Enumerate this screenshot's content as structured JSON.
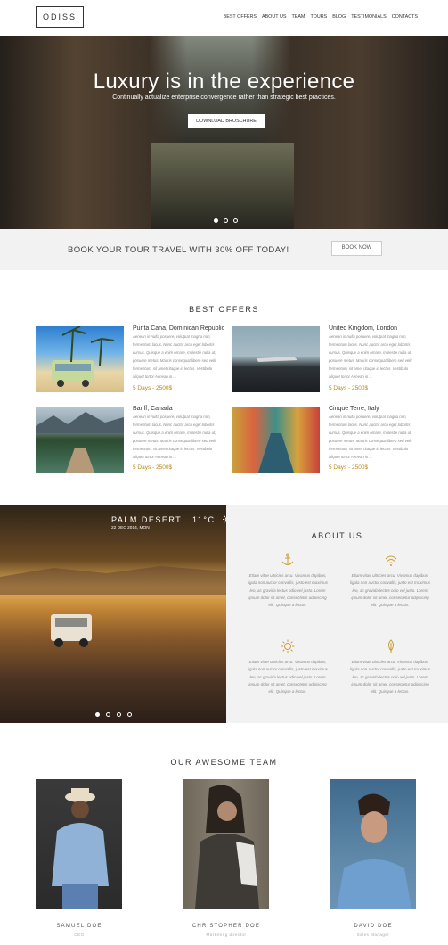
{
  "header": {
    "logo": "ODISS",
    "nav": [
      "BEST OFFERS",
      "ABOUT US",
      "TEAM",
      "TOURS",
      "BLOG",
      "TESTIMONIALS",
      "CONTACTS"
    ]
  },
  "hero": {
    "title": "Luxury is in the experience",
    "subtitle": "Continually actualize enterprise convergence rather than strategic best practices.",
    "button": "DOWNLOAD BROSCHURE",
    "slides": 3,
    "active_slide": 0
  },
  "booking": {
    "text": "BOOK YOUR TOUR TRAVEL WITH 30% OFF TODAY!",
    "button": "BOOK NOW"
  },
  "offers": {
    "title": "BEST OFFERS",
    "items": [
      {
        "title": "Punta Cana, Dominican Republic",
        "desc": "Aenean in nulla posuere, volutpat magna non, fermentum lacus. Nunc auctor arcu eget lobortis cursus. Quisque a enim ornare, molestie nulla ut, posuere metus. Mauris consequat libero sed velit fermentum, sit amet ritaque id lectus. Vestibulo aliquet tortor Aenean in ...",
        "price": "5 Days - 2500$"
      },
      {
        "title": "United Kingdom, London",
        "desc": "Aenean in nulla posuere, volutpat magna non, fermentum lacus. Nunc auctor arcu eget lobortis cursus. Quisque a enim ornare, molestie nulla ut, posuere metus. Mauris consequat libero sed velit fermentum, sit amet ritaque id lectus. Vestibulo aliquet tortor Aenean in ...",
        "price": "5 Days - 2500$"
      },
      {
        "title": "Banff, Canada",
        "desc": "Aenean in nulla posuere, volutpat magna non, fermentum lacus. Nunc auctor arcu eget lobortis cursus. Quisque a enim ornare, molestie nulla ut, posuere metus. Mauris consequat libero sed velit fermentum, sit amet ritaque id lectus. Vestibulo aliquet tortor Aenean in ...",
        "price": "5 Days - 2500$"
      },
      {
        "title": "Cinque Terre, Italy",
        "desc": "Aenean in nulla posuere, volutpat magna non, fermentum lacus. Nunc auctor arcu eget lobortis cursus. Quisque a enim ornare, molestie nulla ut, posuere metus. Mauris consequat libero sed velit fermentum, sit amet ritaque id lectus. Vestibulo aliquet tortor Aenean in ...",
        "price": "5 Days - 2500$"
      }
    ]
  },
  "weather": {
    "location": "PALM DESERT",
    "temp": "11°C",
    "icon": "sun-icon",
    "date": "22 DEC 2014, MON",
    "slides": 4,
    "active_slide": 0
  },
  "about": {
    "title": "ABOUT US",
    "features": [
      {
        "icon": "anchor-icon",
        "text": "Etiam vitae ultricies arcu. Vivamus dapibus, ligula non auctor convallis, justo est maximus leo, ac gravida lectus odio vel justo. Lorem ipsum dolor sit amet, consectetur adipiscing elit. Quisque a lectus."
      },
      {
        "icon": "wifi-icon",
        "text": "Etiam vitae ultricies arcu. Vivamus dapibus, ligula non auctor convallis, justo est maximus leo, ac gravida lectus odio vel justo. Lorem ipsum dolor sit amet, consectetur adipiscing elit. Quisque a lectus."
      },
      {
        "icon": "sun-icon",
        "text": "Etiam vitae ultricies arcu. Vivamus dapibus, ligula non auctor convallis, justo est maximus leo, ac gravida lectus odio vel justo. Lorem ipsum dolor sit amet, consectetur adipiscing elit. Quisque a lectus."
      },
      {
        "icon": "leaf-icon",
        "text": "Etiam vitae ultricies arcu. Vivamus dapibus, ligula non auctor convallis, justo est maximus leo, ac gravida lectus odio vel justo. Lorem ipsum dolor sit amet, consectetur adipiscing elit. Quisque a lectus."
      }
    ]
  },
  "team": {
    "title": "OUR AWESOME TEAM",
    "members": [
      {
        "name": "SAMUEL DOE",
        "role": "CEO"
      },
      {
        "name": "CHRISTOPHER DOE",
        "role": "Marketing director"
      },
      {
        "name": "DAVID DOE",
        "role": "Sales Manager"
      }
    ]
  },
  "colors": {
    "accent": "#b8891b",
    "band": "#f2f2f2"
  }
}
